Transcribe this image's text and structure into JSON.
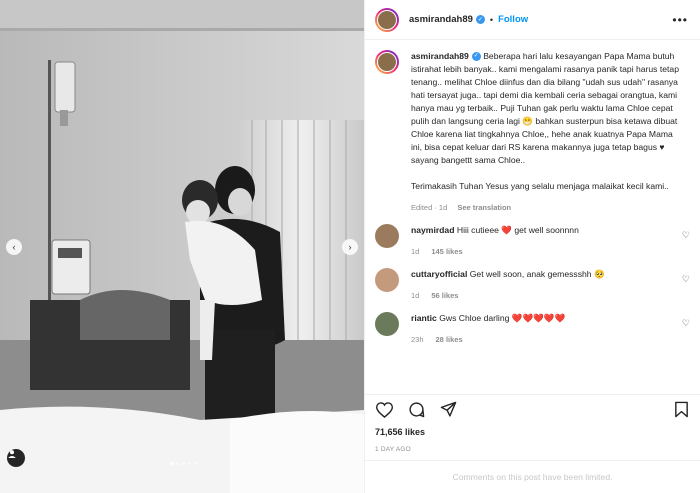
{
  "post": {
    "username": "asmirandah89",
    "follow_label": "Follow",
    "more_label": "•••"
  },
  "caption": {
    "username": "asmirandah89",
    "text": "Beberapa hari lalu kesayangan Papa Mama butuh istirahat lebih banyak.. kami mengalami rasanya panik tapi harus tetap tenang.. melihat Chloe diinfus dan dia bilang \"udah sus udah\" rasanya hati tersayat juga.. tapi demi dia kembali ceria sebagai orangtua, kami hanya mau yg terbaik.. Puji Tuhan gak perlu waktu lama Chloe cepat pulih dan langsung ceria lagi 😁 bahkan susterpun bisa ketawa dibuat Chloe karena liat tingkahnya Chloe,, hehe anak kuatnya Papa Mama ini, bisa cepat keluar dari RS karena makannya juga tetap bagus ♥ sayang bangettt sama Chloe..",
    "text2": "Terimakasih Tuhan Yesus yang selalu menjaga malaikat kecil kami..",
    "edited": "Edited · 1d",
    "see_translation": "See translation"
  },
  "comments": [
    {
      "username": "naymirdad",
      "text": "Hiii cutieee ❤️ get well soonnnn",
      "time": "1d",
      "likes": "145 likes",
      "avatar_color": "#9b7b5e"
    },
    {
      "username": "cuttaryofficial",
      "text": "Get well soon, anak gemessshh 🥺",
      "time": "1d",
      "likes": "56 likes",
      "avatar_color": "#c49a7c"
    },
    {
      "username": "riantic",
      "text": "Gws Chloe darling ❤️❤️❤️❤️❤️",
      "time": "23h",
      "likes": "28 likes",
      "avatar_color": "#6b7a5a"
    }
  ],
  "stats": {
    "likes": "71,656 likes",
    "date": "1 DAY AGO"
  },
  "footer": {
    "limited": "Comments on this post have been limited."
  },
  "photo": {
    "nav_prev": "‹",
    "nav_next": "›"
  },
  "icons": {
    "like": "heart-icon",
    "comment": "comment-icon",
    "share": "share-icon",
    "save": "bookmark-icon",
    "verified": "verified-badge-icon",
    "user_tag": "user-tag-icon"
  },
  "colors": {
    "accent": "#0095f6",
    "verified": "#3897f0",
    "heart": "#ed4956",
    "muted": "#8e8e8e"
  }
}
